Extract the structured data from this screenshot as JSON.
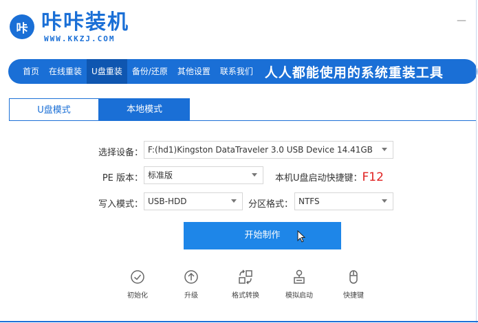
{
  "header": {
    "logo_text": "咔",
    "brand_name": "咔咔装机",
    "brand_url": "WWW.KKZJ.COM",
    "minimize_label": "—"
  },
  "nav": {
    "items": [
      {
        "label": "首页"
      },
      {
        "label": "在线重装"
      },
      {
        "label": "U盘重装"
      },
      {
        "label": "备份/还原"
      },
      {
        "label": "其他设置"
      },
      {
        "label": "联系我们"
      }
    ],
    "active_index": 2,
    "slogan": "人人都能使用的系统重装工具"
  },
  "tabs": {
    "usb_mode": "U盘模式",
    "local_mode": "本地模式"
  },
  "form": {
    "device_label": "选择设备：",
    "device_value": "F:(hd1)Kingston DataTraveler 3.0 USB Device 14.41GB",
    "pe_label": "PE 版本：",
    "pe_value": "标准版",
    "hotkey_label": "本机U盘启动快捷键：",
    "hotkey_value": "F12",
    "write_label": "写入模式：",
    "write_value": "USB-HDD",
    "partition_label": "分区格式：",
    "partition_value": "NTFS"
  },
  "actions": {
    "start_label": "开始制作"
  },
  "tools": {
    "init": "初始化",
    "upgrade": "升级",
    "format_convert": "格式转换",
    "simulate_boot": "模拟启动",
    "shortcut": "快捷键"
  },
  "colors": {
    "brand_blue": "#1a6fd6",
    "button_blue": "#1e86e8",
    "hotkey_red": "#e02020"
  }
}
